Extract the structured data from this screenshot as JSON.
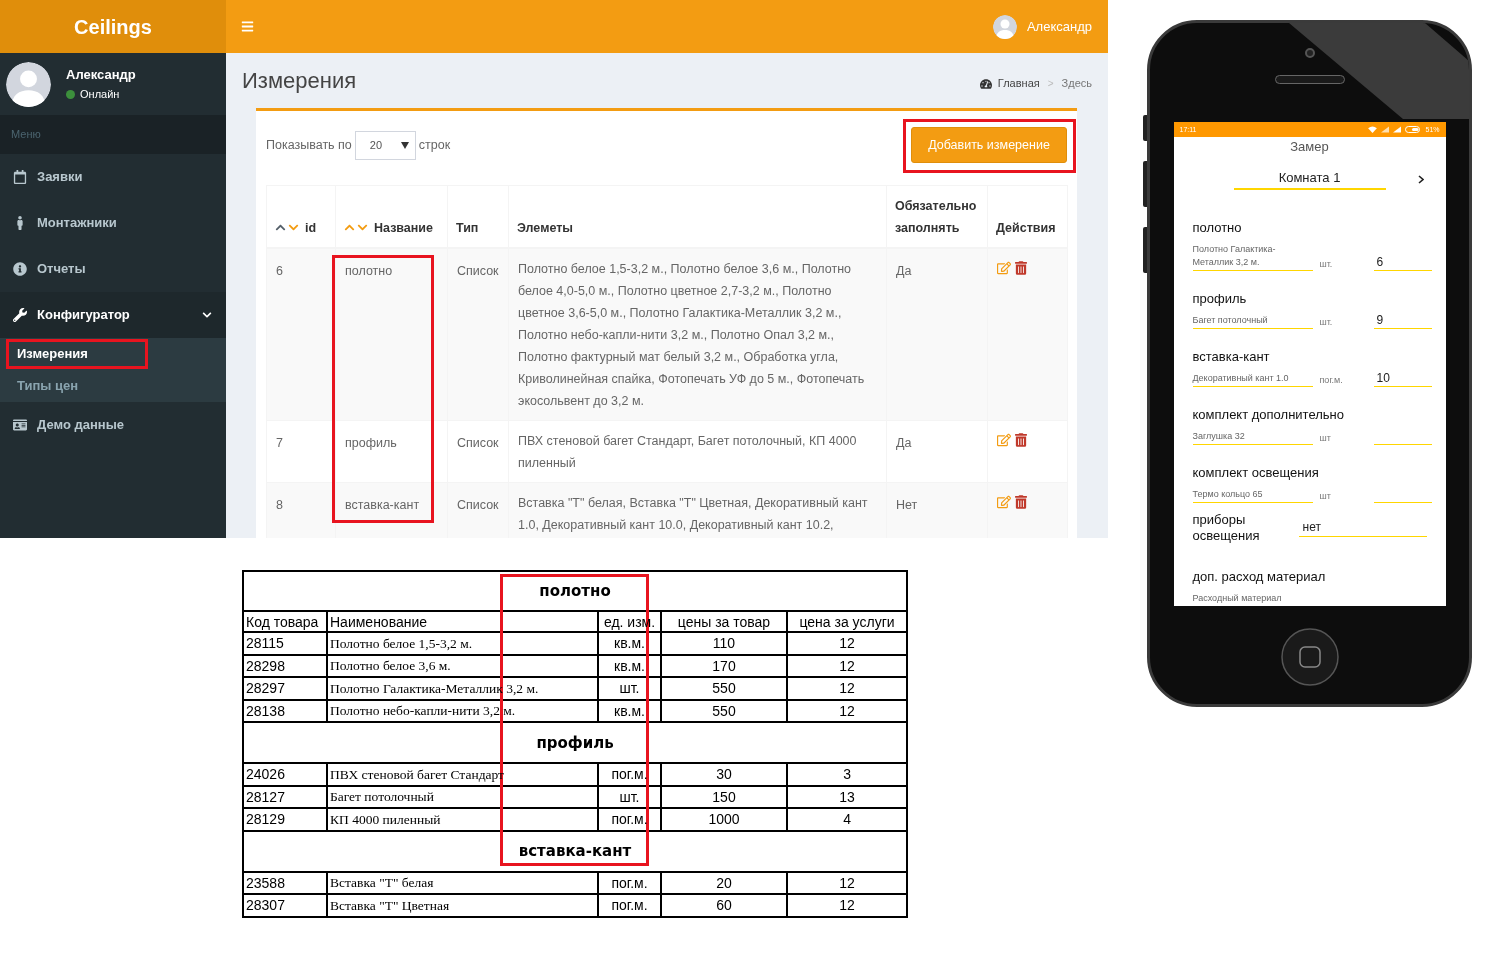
{
  "admin": {
    "header": {
      "logo": "Ceilings",
      "user_name": "Александр"
    },
    "sidebar": {
      "user": {
        "name": "Александр",
        "status": "Онлайн",
        "online": true
      },
      "menu_label": "Меню",
      "items": [
        {
          "label": "Заявки",
          "selected": false
        },
        {
          "label": "Монтажники",
          "selected": false
        },
        {
          "label": "Отчеты",
          "selected": false
        },
        {
          "label": "Конфигуратор",
          "selected": true,
          "expanded": true,
          "children": [
            {
              "label": "Измерения",
              "selected": true,
              "highlighted": true
            },
            {
              "label": "Типы цен",
              "selected": false,
              "highlighted": false
            }
          ]
        },
        {
          "label": "Демо данные",
          "selected": false
        }
      ]
    },
    "content": {
      "title": "Измерения",
      "breadcrumb": [
        {
          "label": "Главная"
        },
        {
          "label": "Здесь"
        }
      ],
      "breadcrumb_separator": ">",
      "length_menu": {
        "before": "Показывать по",
        "value": "20",
        "after": "строк"
      },
      "add_button": {
        "label": "Добавить измерение",
        "highlighted": true
      },
      "table": {
        "names_highlighted": true,
        "columns": [
          {
            "label": "id",
            "sort": {
              "up": false,
              "down": true
            }
          },
          {
            "label": "Название",
            "sort": {
              "up": true,
              "down": true
            }
          },
          {
            "label": "Тип"
          },
          {
            "label": "Элеметы"
          },
          {
            "label": "Обязательно заполнять"
          },
          {
            "label": "Действия"
          }
        ],
        "rows": [
          {
            "id": "6",
            "name": "полотно",
            "type": "Список",
            "elements": "Полотно белое 1,5-3,2 м., Полотно белое 3,6 м., Полотно белое 4,0-5,0 м., Полотно цветное 2,7-3,2 м., Полотно цветное 3,6-5,0 м., Полотно Галактика-Металлик 3,2 м., Полотно небо-капли-нити 3,2 м., Полотно Опал 3,2 м., Полотно фактурный мат белый 3,2 м., Обработка угла, Криволинейная спайка, Фотопечать УФ до 5 м., Фотопечать экосольвент до 3,2 м.",
            "required": "Да"
          },
          {
            "id": "7",
            "name": "профиль",
            "type": "Список",
            "elements": "ПВХ стеновой багет Стандарт, Багет потолочный, КП 4000 пиленный",
            "required": "Да"
          },
          {
            "id": "8",
            "name": "вставка-кант",
            "type": "Список",
            "elements": "Вставка \"Т\" белая, Вставка \"Т\" Цветная, Декоративный кант 1.0, Декоративный кант 10.0, Декоративный кант 10.2,",
            "required": "Нет"
          }
        ]
      }
    }
  },
  "price_sheet": {
    "titles_highlighted": true,
    "columns": [
      "Код товара",
      "Наименование",
      "ед. изм.",
      "цены за товар",
      "цена за услуги"
    ],
    "groups": [
      {
        "title": "полотно",
        "rows": [
          [
            "28115",
            "Полотно белое 1,5-3,2 м.",
            "кв.м.",
            "110",
            "12"
          ],
          [
            "28298",
            "Полотно белое 3,6 м.",
            "кв.м.",
            "170",
            "12"
          ],
          [
            "28297",
            "Полотно Галактика-Металлик 3,2 м.",
            "шт.",
            "550",
            "12"
          ],
          [
            "28138",
            "Полотно небо-капли-нити 3,2 м.",
            "кв.м.",
            "550",
            "12"
          ]
        ]
      },
      {
        "title": "профиль",
        "rows": [
          [
            "24026",
            "ПВХ стеновой багет Стандарт",
            "пог.м.",
            "30",
            "3"
          ],
          [
            "28127",
            "Багет потолочный",
            "шт.",
            "150",
            "13"
          ],
          [
            "28129",
            "КП 4000 пиленный",
            "пог.м.",
            "1000",
            "4"
          ]
        ]
      },
      {
        "title": "вставка-кант",
        "rows": [
          [
            "23588",
            "Вставка \"Т\" белая",
            "пог.м.",
            "20",
            "12"
          ],
          [
            "28307",
            "Вставка \"Т\" Цветная",
            "пог.м.",
            "60",
            "12"
          ]
        ]
      }
    ]
  },
  "phone": {
    "status_bar": {
      "time": "17:11",
      "battery": "51%"
    },
    "title": "Замер",
    "room": "Комната 1",
    "sections": [
      {
        "kind": "item",
        "title": "полотно",
        "item": "Полотно Галактика-Металлик 3,2 м.",
        "unit": "шт.",
        "quantity": "6"
      },
      {
        "kind": "item",
        "title": "профиль",
        "item": "Багет потолочный",
        "unit": "шт.",
        "quantity": "9"
      },
      {
        "kind": "item",
        "title": "вставка-кант",
        "item": "Декоративный кант 1.0",
        "unit": "пог.м.",
        "quantity": "10"
      },
      {
        "kind": "item",
        "title": "комплект дополнительно",
        "item": "Заглушка 32",
        "unit": "шт"
      },
      {
        "kind": "item",
        "title": "комплект освещения",
        "item": "Термо кольцо 65",
        "unit": "шт"
      },
      {
        "kind": "select",
        "title": "приборы освещения",
        "value": "нет"
      },
      {
        "kind": "item",
        "title": "доп. расход материал",
        "item": "Расходный материал"
      }
    ]
  }
}
